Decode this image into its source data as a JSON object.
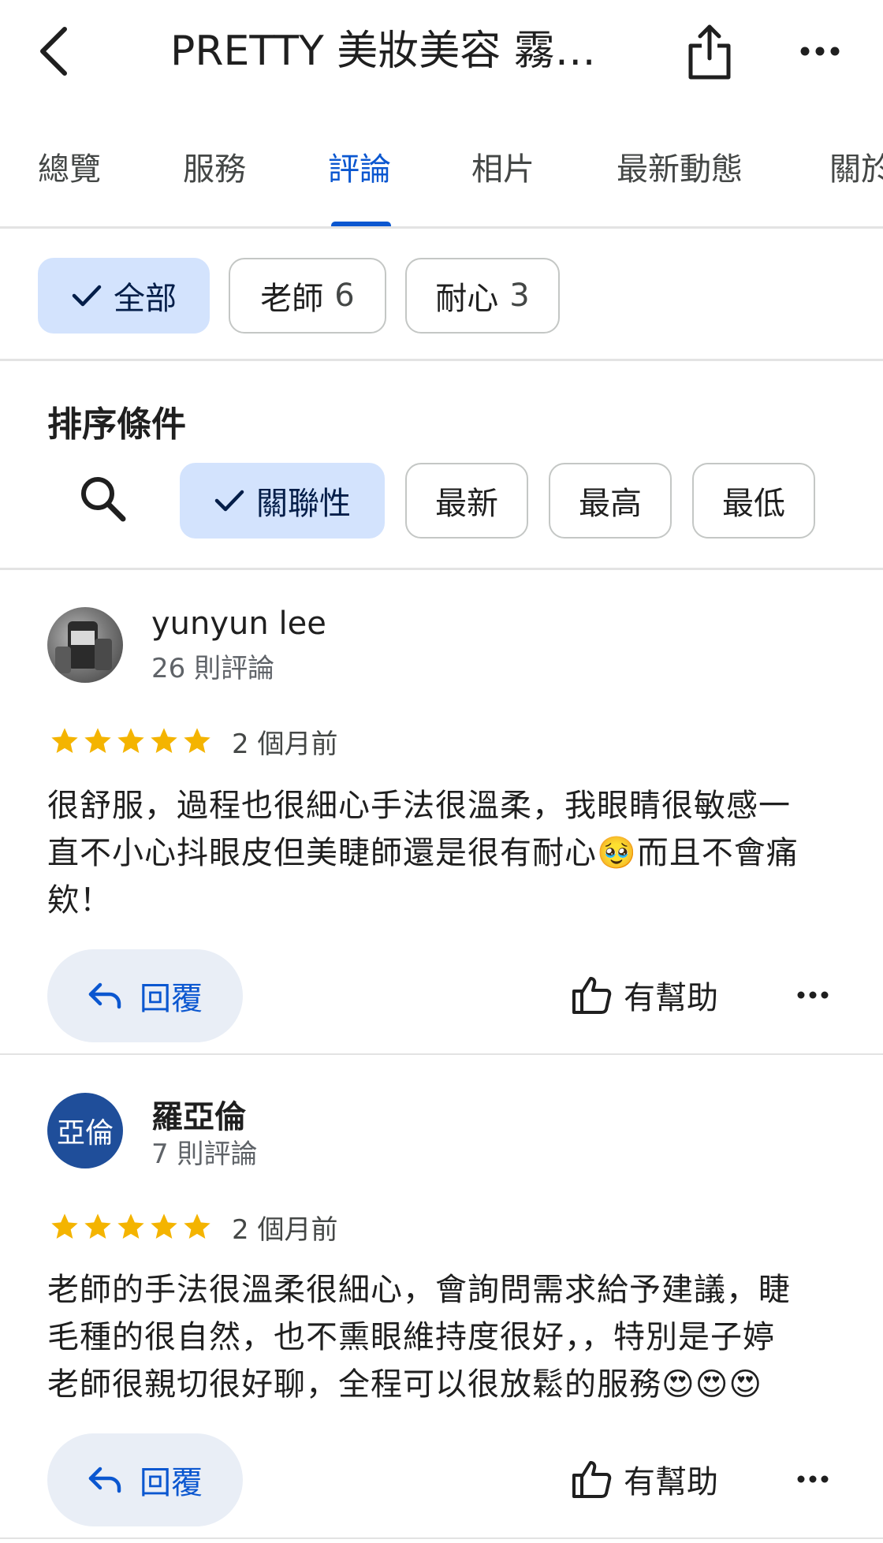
{
  "header": {
    "title": "PRETTY 美妝美容 霧…",
    "back_icon": "back-chevron-icon",
    "share_icon": "share-icon",
    "more_icon": "more-horizontal-icon"
  },
  "tabs": [
    {
      "label": "總覽",
      "active": false
    },
    {
      "label": "服務",
      "active": false
    },
    {
      "label": "評論",
      "active": true
    },
    {
      "label": "相片",
      "active": false
    },
    {
      "label": "最新動態",
      "active": false
    },
    {
      "label": "關於",
      "active": false
    }
  ],
  "filters": {
    "all": {
      "label": "全部",
      "selected": true
    },
    "teacher": {
      "label": "老師",
      "count": "6"
    },
    "patience": {
      "label": "耐心",
      "count": "3"
    }
  },
  "sort": {
    "title": "排序條件",
    "options": [
      {
        "label": "關聯性",
        "selected": true
      },
      {
        "label": "最新",
        "selected": false
      },
      {
        "label": "最高",
        "selected": false
      },
      {
        "label": "最低",
        "selected": false
      }
    ]
  },
  "reviews": [
    {
      "name": "yunyun lee",
      "count": "26 則評論",
      "rating": 5,
      "date": "2 個月前",
      "text_line1": "很舒服，過程也很細心手法很溫柔，我眼睛很敏感一",
      "text_line2": "直不小心抖眼皮但美睫師還是很有耐心🥹而且不會痛",
      "text_line3": "欸！",
      "reply_label": "回覆",
      "helpful_label": "有幫助"
    },
    {
      "name": "羅亞倫",
      "avatar_text": "亞倫",
      "avatar_color": "#1f4e9a",
      "count": "7 則評論",
      "rating": 5,
      "date": "2 個月前",
      "text_line1": "老師的手法很溫柔很細心，會詢問需求給予建議，睫",
      "text_line2": "毛種的很自然，也不熏眼維持度很好，，特別是子婷",
      "text_line3": "老師很親切很好聊，全程可以很放鬆的服務😍😍😍",
      "reply_label": "回覆",
      "helpful_label": "有幫助"
    }
  ],
  "colors": {
    "accent": "#0b57d0",
    "chip_selected_bg": "#d3e3fd",
    "star": "#f4b400",
    "reply_bg": "#e9eef6"
  }
}
